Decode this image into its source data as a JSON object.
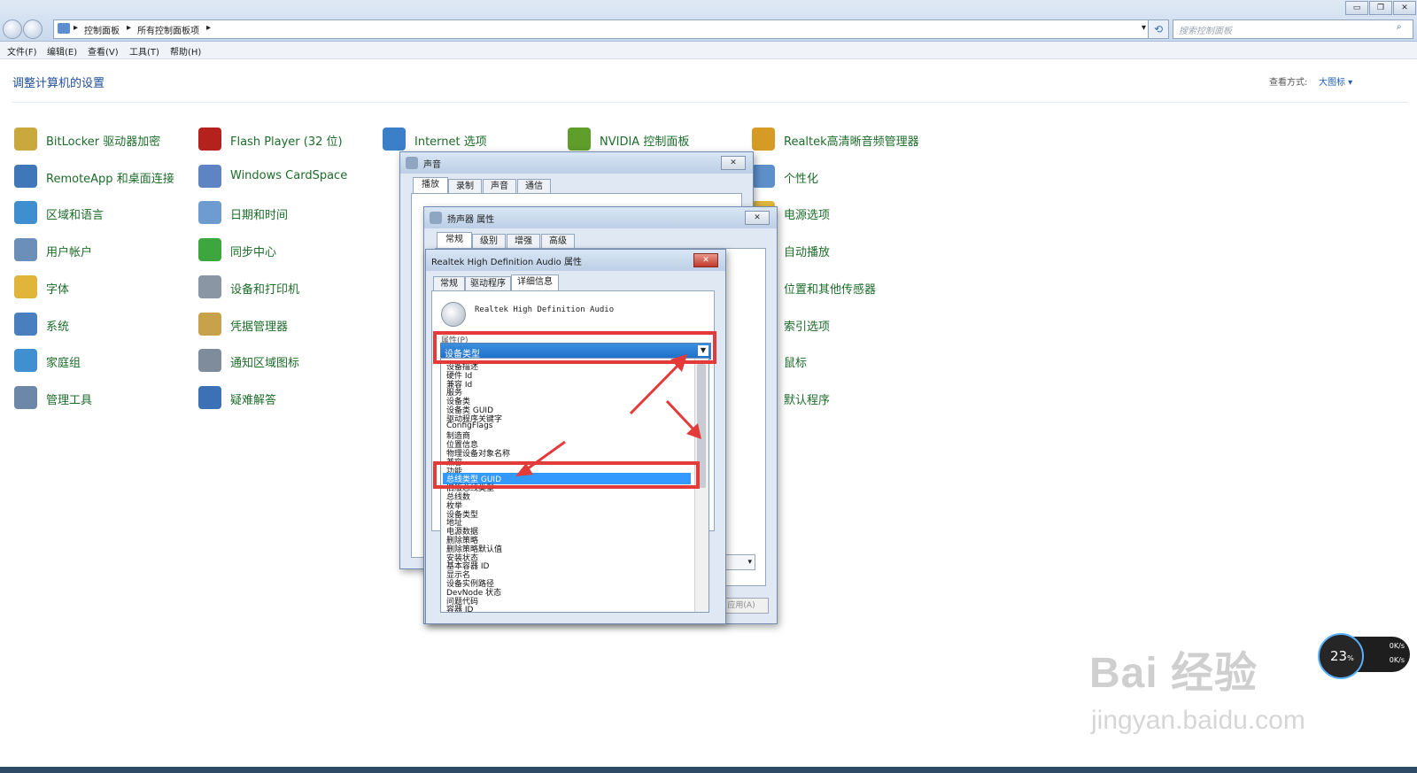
{
  "address": {
    "crumb1": "控制面板",
    "crumb2": "所有控制面板项",
    "search_placeholder": "搜索控制面板"
  },
  "menu": [
    "文件(F)",
    "编辑(E)",
    "查看(V)",
    "工具(T)",
    "帮助(H)"
  ],
  "header": {
    "title": "调整计算机的设置",
    "view_label": "查看方式:",
    "view_value": "大图标 ▾"
  },
  "control_items": [
    {
      "label": "BitLocker 驱动器加密",
      "icon": "bitlocker-icon",
      "color": "#c9a83e"
    },
    {
      "label": "Flash Player (32 位)",
      "icon": "flash-icon",
      "color": "#b5221d"
    },
    {
      "label": "Internet 选项",
      "icon": "internet-icon",
      "color": "#3a7fc7"
    },
    {
      "label": "NVIDIA 控制面板",
      "icon": "nvidia-icon",
      "color": "#5f9e2b"
    },
    {
      "label": "Realtek高清晰音频管理器",
      "icon": "realtek-icon",
      "color": "#d69b25"
    },
    {
      "label": "RemoteApp 和桌面连接",
      "icon": "remoteapp-icon",
      "color": "#3f77b8"
    },
    {
      "label": "Windows CardSpace",
      "icon": "cardspace-icon",
      "color": "#5f84c4"
    },
    {
      "label": "个性化",
      "icon": "personalize-icon",
      "color": "#5d8fc9"
    },
    {
      "label": "区域和语言",
      "icon": "region-icon",
      "color": "#3e8ed0"
    },
    {
      "label": "日期和时间",
      "icon": "datetime-icon",
      "color": "#6e9bd0"
    },
    {
      "label": "电源选项",
      "icon": "power-icon",
      "color": "#e1b840"
    },
    {
      "label": "用户帐户",
      "icon": "users-icon",
      "color": "#6b8fb9"
    },
    {
      "label": "同步中心",
      "icon": "sync-icon",
      "color": "#3ea63f"
    },
    {
      "label": "自动播放",
      "icon": "autoplay-icon",
      "color": "#2f7ac4"
    },
    {
      "label": "字体",
      "icon": "fonts-icon",
      "color": "#e0b53a"
    },
    {
      "label": "设备和打印机",
      "icon": "printer-icon",
      "color": "#8a96a4"
    },
    {
      "label": "位置和其他传感器",
      "icon": "sensor-icon",
      "color": "#7a8da0"
    },
    {
      "label": "系统",
      "icon": "system-icon",
      "color": "#4a7fbf"
    },
    {
      "label": "凭据管理器",
      "icon": "credential-icon",
      "color": "#c8a24a"
    },
    {
      "label": "索引选项",
      "icon": "index-icon",
      "color": "#8b97a6"
    },
    {
      "label": "家庭组",
      "icon": "homegroup-icon",
      "color": "#3f8fd1"
    },
    {
      "label": "通知区域图标",
      "icon": "tray-icon",
      "color": "#7e8c9b"
    },
    {
      "label": "鼠标",
      "icon": "mouse-icon",
      "color": "#7b7b7b"
    },
    {
      "label": "管理工具",
      "icon": "admin-tools-icon",
      "color": "#6d87a8"
    },
    {
      "label": "疑难解答",
      "icon": "troubleshoot-icon",
      "color": "#3c72b5"
    },
    {
      "label": "默认程序",
      "icon": "default-programs-icon",
      "color": "#4c9a3e"
    }
  ],
  "sound_dialog": {
    "title": "声音",
    "tabs": [
      "播放",
      "录制",
      "声音",
      "通信"
    ]
  },
  "speaker_dialog": {
    "title": "扬声器 属性",
    "tabs": [
      "常规",
      "级别",
      "增强",
      "高级"
    ],
    "apply": "应用(A)"
  },
  "realtek_dialog": {
    "title": "Realtek High Definition Audio 属性",
    "tabs": [
      "常规",
      "驱动程序",
      "详细信息"
    ],
    "device_name": "Realtek High Definition Audio",
    "property_label": "属性(P)",
    "property_value": "设备类型",
    "list_items": [
      "设备描述",
      "硬件 Id",
      "兼容 Id",
      "服务",
      "设备类",
      "设备类 GUID",
      "驱动程序关键字",
      "ConfigFlags",
      "制造商",
      "位置信息",
      "物理设备对象名称",
      "兼容",
      "功能",
      "总线类型 GUID",
      "旧版总线类型",
      "总线数",
      "枚举",
      "设备类型",
      "地址",
      "电源数据",
      "删除策略",
      "删除策略默认值",
      "安装状态",
      "基本容器 ID",
      "显示名",
      "设备实例路径",
      "DevNode 状态",
      "问题代码",
      "容器 ID"
    ],
    "selected_index": 13
  },
  "gauge": {
    "value": "23",
    "unit": "%",
    "up": "0K/s",
    "down": "0K/s"
  },
  "watermark": {
    "main": "Bai 经验",
    "sub": "jingyan.baidu.com"
  }
}
